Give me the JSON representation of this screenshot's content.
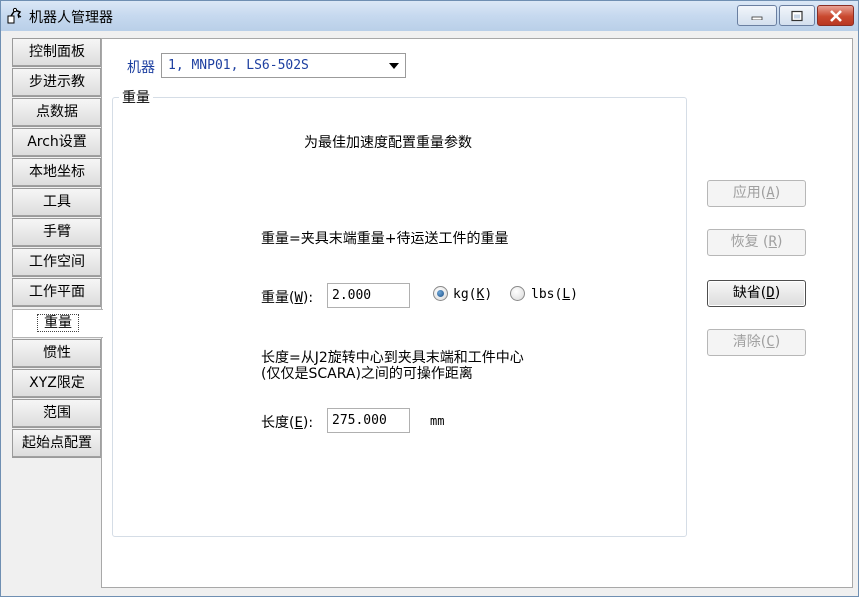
{
  "window": {
    "title": "机器人管理器"
  },
  "sidebar": {
    "items": [
      {
        "label": "控制面板"
      },
      {
        "label": "步进示教"
      },
      {
        "label": "点数据"
      },
      {
        "label": "Arch设置"
      },
      {
        "label": "本地坐标"
      },
      {
        "label": "工具"
      },
      {
        "label": "手臂"
      },
      {
        "label": "工作空间"
      },
      {
        "label": "工作平面"
      },
      {
        "label": "重量"
      },
      {
        "label": "惯性"
      },
      {
        "label": "XYZ限定"
      },
      {
        "label": "范围"
      },
      {
        "label": "起始点配置"
      }
    ],
    "active_index": 9
  },
  "robot": {
    "label": "机器",
    "selected": "1, MNP01, LS6-502S"
  },
  "group": {
    "title": "重量",
    "description": "为最佳加速度配置重量参数",
    "weight_formula": "重量=夹具末端重量+待运送工件的重量",
    "weight_label_prefix": "重量(",
    "weight_label_key": "W",
    "weight_label_suffix": "):",
    "weight_value": "2.000",
    "unit_kg_prefix": "kg(",
    "unit_kg_key": "K",
    "unit_kg_suffix": ")",
    "unit_lbs_prefix": "lbs(",
    "unit_lbs_key": "L",
    "unit_lbs_suffix": ")",
    "selected_unit": "kg",
    "length_desc_line1": "长度=从J2旋转中心到夹具末端和工件中心",
    "length_desc_line2": "(仅仅是SCARA)之间的可操作距离",
    "length_label_prefix": "长度(",
    "length_label_key": "E",
    "length_label_suffix": "):",
    "length_value": "275.000",
    "length_unit": "mm"
  },
  "actions": {
    "apply_prefix": "应用(",
    "apply_key": "A",
    "apply_suffix": ")",
    "restore_prefix": "恢复 (",
    "restore_key": "R",
    "restore_suffix": ")",
    "default_prefix": "缺省(",
    "default_key": "D",
    "default_suffix": ")",
    "clear_prefix": "清除(",
    "clear_key": "C",
    "clear_suffix": ")"
  },
  "colors": {
    "accent_text": "#1d3fa0",
    "close_button": "#c9492f"
  }
}
